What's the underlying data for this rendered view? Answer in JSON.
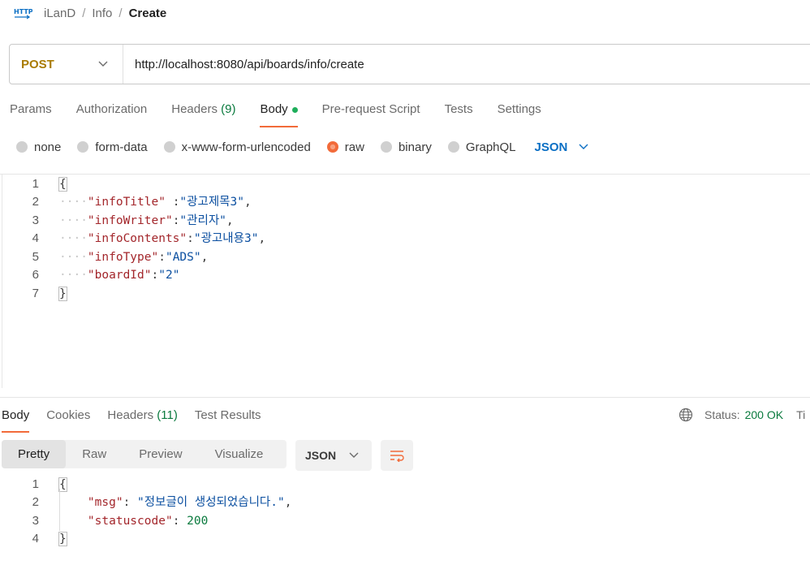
{
  "breadcrumb": {
    "icon_label": "HTTP",
    "items": [
      "iLanD",
      "Info"
    ],
    "current": "Create",
    "separator": "/"
  },
  "request": {
    "method": "POST",
    "url": "http://localhost:8080/api/boards/info/create"
  },
  "request_tabs": [
    {
      "label": "Params"
    },
    {
      "label": "Authorization"
    },
    {
      "label": "Headers",
      "count": "(9)"
    },
    {
      "label": "Body",
      "active": true,
      "dot": true
    },
    {
      "label": "Pre-request Script"
    },
    {
      "label": "Tests"
    },
    {
      "label": "Settings"
    }
  ],
  "body_types": [
    "none",
    "form-data",
    "x-www-form-urlencoded",
    "raw",
    "binary",
    "GraphQL"
  ],
  "body_type_selected": "raw",
  "body_format": "JSON",
  "request_body": {
    "line_numbers": [
      "1",
      "2",
      "3",
      "4",
      "5",
      "6",
      "7"
    ],
    "open_brace": "{",
    "close_brace": "}",
    "fields": [
      {
        "key": "\"infoTitle\"",
        "value": "\"광고제목3\"",
        "gap": " ",
        "comma": ","
      },
      {
        "key": "\"infoWriter\"",
        "value": "\"관리자\"",
        "gap": "",
        "comma": ","
      },
      {
        "key": "\"infoContents\"",
        "value": "\"광고내용3\"",
        "gap": "",
        "comma": ","
      },
      {
        "key": "\"infoType\"",
        "value": "\"ADS\"",
        "gap": "",
        "comma": ","
      },
      {
        "key": "\"boardId\"",
        "value": "\"2\"",
        "gap": "",
        "comma": ""
      }
    ]
  },
  "response_tabs": [
    {
      "label": "Body",
      "active": true
    },
    {
      "label": "Cookies"
    },
    {
      "label": "Headers",
      "count": "(11)"
    },
    {
      "label": "Test Results"
    }
  ],
  "status": {
    "label": "Status:",
    "value": "200 OK",
    "time_label": "Ti"
  },
  "view_modes": [
    "Pretty",
    "Raw",
    "Preview",
    "Visualize"
  ],
  "view_mode_selected": "Pretty",
  "response_format": "JSON",
  "response_body": {
    "line_numbers": [
      "1",
      "2",
      "3",
      "4"
    ],
    "open_brace": "{",
    "close_brace": "}",
    "msg_key": "\"msg\"",
    "msg_value": "\"정보글이 생성되었습니다.\"",
    "status_key": "\"statuscode\"",
    "status_value": "200"
  },
  "colors": {
    "accent": "#f26b3a",
    "method": "#a97b00",
    "link": "#0b6fc4",
    "success": "#0a7a3e"
  }
}
